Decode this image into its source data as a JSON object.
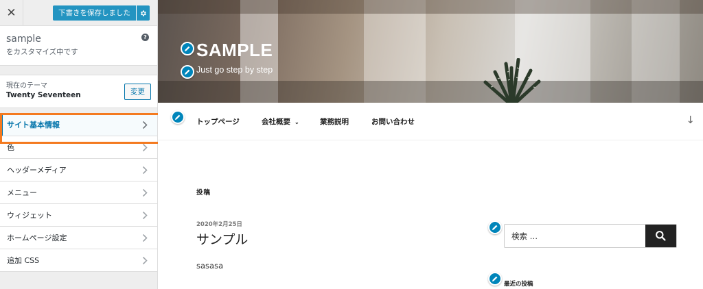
{
  "customizer": {
    "header": {
      "close_icon": "close-icon",
      "publish_label": "下書きを保存しました",
      "settings_icon": "gear-icon",
      "accent": "#0085ba"
    },
    "info": {
      "site_name": "sample",
      "customizing_label": "をカスタマイズ中です",
      "help_icon": "help-icon"
    },
    "theme": {
      "label": "現在のテーマ",
      "name": "Twenty Seventeen",
      "change_button": "変更"
    },
    "panels": [
      {
        "label": "サイト基本情報",
        "active": true
      },
      {
        "label": "色"
      },
      {
        "label": "ヘッダーメディア"
      },
      {
        "label": "メニュー"
      },
      {
        "label": "ウィジェット"
      },
      {
        "label": "ホームページ設定"
      },
      {
        "label": "追加 CSS"
      }
    ],
    "highlight_color": "#f47a1f"
  },
  "preview": {
    "site_title": "SAMPLE",
    "site_description": "Just go step by step",
    "nav": {
      "items": [
        "トップページ",
        "会社概要",
        "業務説明",
        "お問い合わせ"
      ],
      "dropdown_icon": "chevron-down-icon",
      "scroll_icon": "arrow-down-icon"
    },
    "posts_heading": "投稿",
    "post": {
      "date": "2020年2月25日",
      "title": "サンプル",
      "excerpt": "sasasa"
    },
    "search": {
      "placeholder": "検索 …",
      "button_icon": "search-icon"
    },
    "recent_posts_title": "最近の投稿",
    "edit_icon": "pencil-icon"
  }
}
